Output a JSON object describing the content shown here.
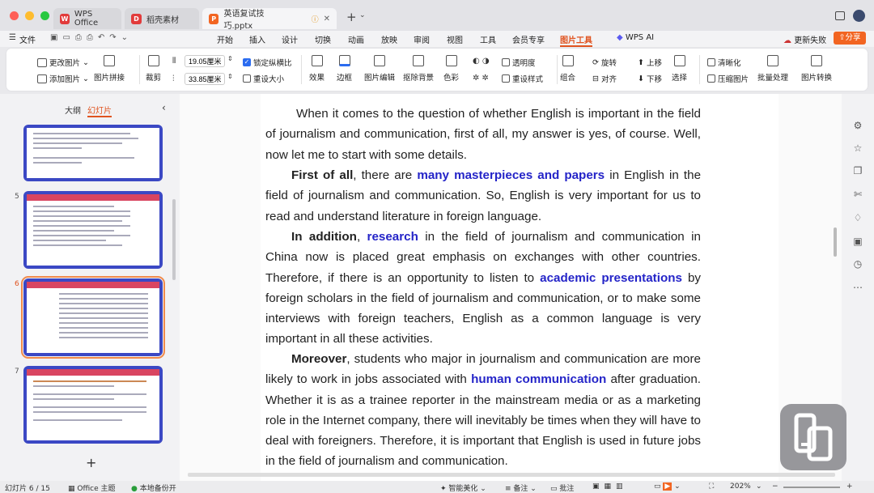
{
  "tabs": [
    {
      "label": "WPS Office"
    },
    {
      "label": "稻壳素材"
    },
    {
      "label": "英语复试技巧.pptx"
    }
  ],
  "menu": {
    "file": "文件",
    "items": [
      "开始",
      "插入",
      "设计",
      "切换",
      "动画",
      "放映",
      "审阅",
      "视图",
      "工具",
      "会员专享",
      "图片工具",
      "WPS AI"
    ],
    "update": "更新失败",
    "share": "分享"
  },
  "ribbon": {
    "change_picture": "更改图片",
    "add_picture": "添加图片",
    "picture_splice": "图片拼接",
    "crop": "裁剪",
    "width": "19.05厘米",
    "height": "33.85厘米",
    "lock_ratio": "锁定纵横比",
    "reset_size": "重设大小",
    "effects": "效果",
    "border": "边框",
    "picture_edit": "图片编辑",
    "remove_bg": "抠除背景",
    "color": "色彩",
    "transparency": "透明度",
    "reset_style": "重设样式",
    "group": "组合",
    "rotate": "旋转",
    "align": "对齐",
    "bring_up": "上移",
    "send_down": "下移",
    "select": "选择",
    "sharpen": "清晰化",
    "compress": "压缩图片",
    "batch": "批量处理",
    "convert": "图片转换"
  },
  "sidebar": {
    "outline_tab": "大纲",
    "slides_tab": "幻灯片",
    "slide_numbers": [
      "5",
      "6",
      "7"
    ],
    "add": "+"
  },
  "document": {
    "p1": "When it comes to the question of whether English is important in the field of journalism and communication, first of all, my answer is yes, of course. Well, now let me to start with some details.",
    "p2_lead": "First of all",
    "p2_a": ", there are ",
    "p2_hl": "many masterpieces and papers",
    "p2_b": " in English in the field of journalism and communication. So, English is very important for us to read and understand literature in foreign language.",
    "p3_lead": "In addition",
    "p3_a": ", ",
    "p3_hl1": "research",
    "p3_b": " in the field of journalism and communication in China now is placed great emphasis on exchanges with other countries. Therefore, if there is an opportunity to listen to ",
    "p3_hl2": "academic presentations",
    "p3_c": " by foreign scholars in the field of journalism and communication, or to make some interviews with foreign teachers, English as a common language is very important in all these activities.",
    "p4_lead": "Moreover",
    "p4_a": ", students who major in journalism and communication are more likely to work in jobs associated with ",
    "p4_hl": "human communication",
    "p4_b": " after graduation. Whether it is as a trainee reporter in the mainstream media or as a marketing role in the Internet company, there will inevitably be times when they will have to deal with foreigners. Therefore, it is important that English is used in future jobs in the field of journalism and communication."
  },
  "status": {
    "slide": "幻灯片 6 / 15",
    "theme": "Office 主题",
    "backup": "本地备份开",
    "beautify": "智能美化",
    "notes": "备注",
    "comment": "批注",
    "zoom": "202%"
  },
  "colors": {
    "accent": "#2424c8",
    "slide_bar": "#d94561",
    "thumb_border": "#3b48c4",
    "share": "#f26522"
  }
}
